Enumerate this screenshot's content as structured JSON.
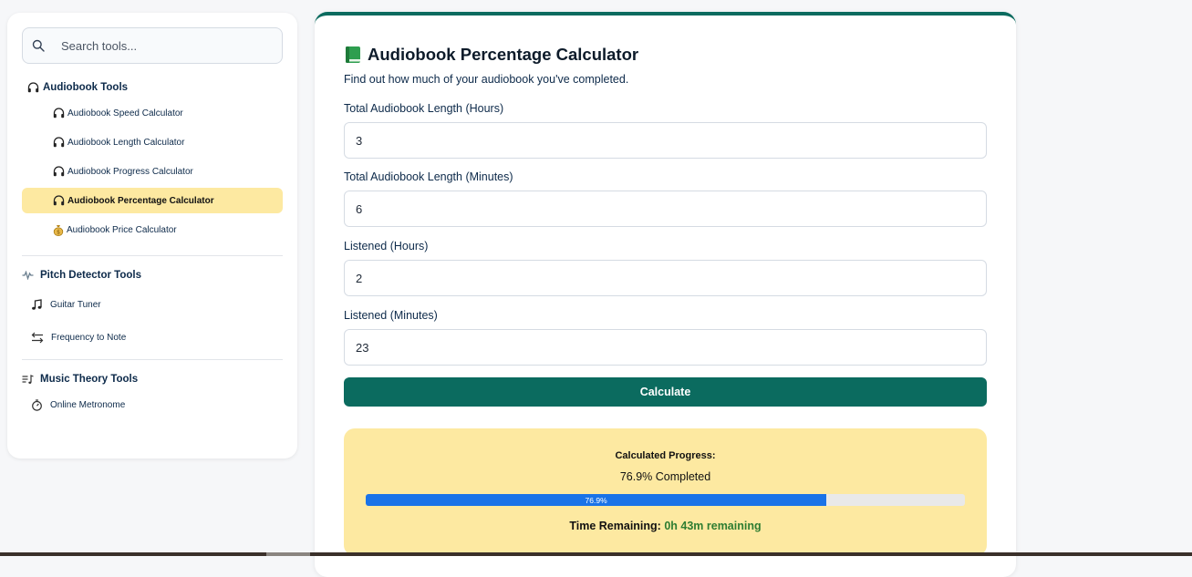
{
  "sidebar": {
    "search_placeholder": "Search tools...",
    "categories": [
      {
        "title": "Audiobook Tools",
        "icon": "headphones-icon",
        "items": [
          {
            "label": "Audiobook Speed Calculator",
            "icon": "headphones-icon"
          },
          {
            "label": "Audiobook Length Calculator",
            "icon": "headphones-icon"
          },
          {
            "label": "Audiobook Progress Calculator",
            "icon": "headphones-icon"
          },
          {
            "label": "Audiobook Percentage Calculator",
            "icon": "headphones-icon",
            "active": true
          },
          {
            "label": "Audiobook Price Calculator",
            "icon": "money-bag-icon"
          }
        ]
      },
      {
        "title": "Pitch Detector Tools",
        "icon": "waveform-icon",
        "items": [
          {
            "label": "Guitar Tuner",
            "icon": "music-note-icon"
          },
          {
            "label": "Frequency to Note",
            "icon": "swap-arrows-icon"
          }
        ]
      },
      {
        "title": "Music Theory Tools",
        "icon": "music-list-icon",
        "items": [
          {
            "label": "Online Metronome",
            "icon": "timer-icon"
          }
        ]
      }
    ]
  },
  "main": {
    "title_icon": "green-book-icon",
    "title": "Audiobook Percentage Calculator",
    "subtitle": "Find out how much of your audiobook you've completed.",
    "fields": [
      {
        "label": "Total Audiobook Length (Hours)",
        "value": "3"
      },
      {
        "label": "Total Audiobook Length (Minutes)",
        "value": "6"
      },
      {
        "label": "Listened (Hours)",
        "value": "2"
      },
      {
        "label": "Listened (Minutes)",
        "value": "23"
      }
    ],
    "calculate_label": "Calculate",
    "result": {
      "label": "Calculated Progress:",
      "value": "76.9% Completed",
      "progress_percent": 76.9,
      "progress_text": "76.9%",
      "remaining_label": "Time Remaining:",
      "remaining_value": "0h 43m remaining"
    }
  },
  "colors": {
    "accent": "#0b6b5f",
    "active_item_bg": "#fde9a1",
    "result_bg": "#fde9a1",
    "progress_fill": "#1a73e8",
    "remaining_text": "#2e7d32"
  }
}
